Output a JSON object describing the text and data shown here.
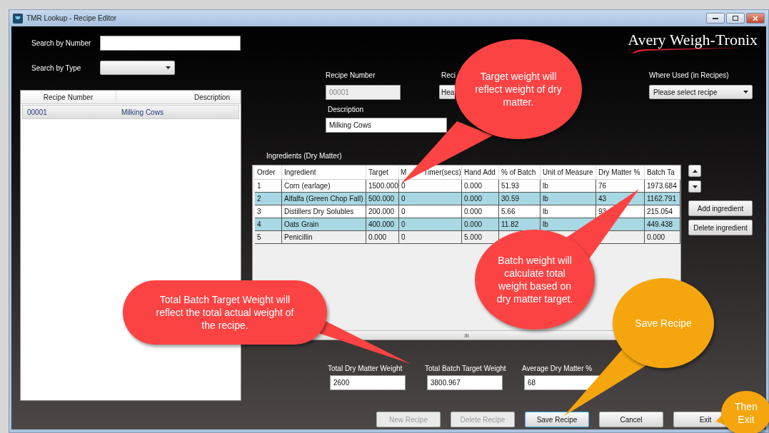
{
  "window": {
    "title": "TMR Lookup - Recipe Editor"
  },
  "logo": {
    "text": "Avery Weigh-Tronix"
  },
  "search": {
    "number_label": "Search by Number",
    "type_label": "Search by Type"
  },
  "recipe_list": {
    "columns": [
      "Recipe Number",
      "Description"
    ],
    "rows": [
      {
        "number": "00001",
        "description": "Milking Cows",
        "selected": true
      }
    ]
  },
  "recipe_number": {
    "label": "Recipe Number",
    "value": "00001",
    "disabled": true
  },
  "recipe_type": {
    "label": "Reci",
    "value": "Hea"
  },
  "where_used": {
    "label": "Where Used (in Recipes)",
    "value": "Please select recipe"
  },
  "description": {
    "label": "Description",
    "value": "Milking Cows"
  },
  "ingredients": {
    "title": "Ingredients (Dry Matter)",
    "columns": [
      "Order",
      "Ingredient",
      "Target",
      [
        "M",
        "Timer(secs)"
      ],
      "Hand Add",
      "% of Batch",
      "Unit of Measure",
      "Dry Matter %",
      "Batch Ta"
    ],
    "rows": [
      [
        "1",
        "Corn (earlage)",
        "1500.000",
        "0",
        "0.000",
        "51.93",
        "lb",
        "76",
        "1973.684"
      ],
      [
        "2",
        "Alfalfa (Green Chop Fall)",
        "500.000",
        "0",
        "0.000",
        "30.59",
        "lb",
        "43",
        "1162.791"
      ],
      [
        "3",
        "Distillers Dry Solubles",
        "200.000",
        "0",
        "0.000",
        "5.66",
        "lb",
        "93",
        "215.054"
      ],
      [
        "4",
        "Oats Grain",
        "400.000",
        "0",
        "0.000",
        "11.82",
        "lb",
        null,
        "449.438"
      ],
      [
        "5",
        "Penicillin",
        "0.000",
        "0",
        "5.000",
        null,
        null,
        null,
        "0.000"
      ]
    ],
    "side_buttons": [
      "Add ingredient",
      "Delete ingredient"
    ],
    "scroll_grip": "III"
  },
  "totals": [
    {
      "label": "Total Dry Matter Weight",
      "value": "2600"
    },
    {
      "label": "Total Batch Target Weight",
      "value": "3800.967"
    },
    {
      "label": "Average Dry Matter %",
      "value": "68"
    }
  ],
  "buttons": [
    {
      "label": "New Recipe",
      "disabled": true,
      "focused": false
    },
    {
      "label": "Delete Recipe",
      "disabled": true,
      "focused": false
    },
    {
      "label": "Save Recipe",
      "disabled": false,
      "focused": true
    },
    {
      "label": "Cancel",
      "disabled": false,
      "focused": false
    },
    {
      "label": "Exit",
      "disabled": false,
      "focused": false
    }
  ],
  "callouts": [
    {
      "text": "Target weight will reflect weight of dry matter.",
      "color": "#fc4343"
    },
    {
      "text": "Batch weight will calculate total weight based on dry matter target.",
      "color": "#fc4343"
    },
    {
      "text": "Total Batch Target Weight will reflect the total actual weight of the recipe.",
      "color": "#fc4343"
    },
    {
      "text": "Save Recipe",
      "color": "#f5a60e"
    },
    {
      "text": "Then Exit",
      "color": "#f5a60e"
    }
  ]
}
